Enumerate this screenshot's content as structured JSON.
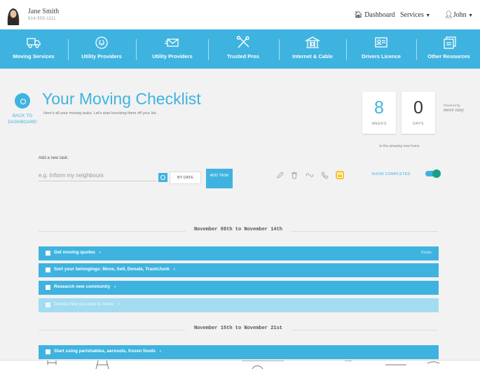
{
  "user": {
    "name": "Jane Smith",
    "phone": "614-555-1111"
  },
  "topnav": {
    "dashboard": "Dashboard",
    "services": "Services",
    "account": "John"
  },
  "categories": [
    {
      "label": "Moving Services",
      "icon": "truck-icon"
    },
    {
      "label": "Utility Providers",
      "icon": "plug-icon"
    },
    {
      "label": "Utility Providers",
      "icon": "envelope-icon"
    },
    {
      "label": "Trusted Pros",
      "icon": "tools-icon"
    },
    {
      "label": "Internet & Cable",
      "icon": "building-icon"
    },
    {
      "label": "Drivers Licence",
      "icon": "id-card-icon"
    },
    {
      "label": "Other Resources",
      "icon": "cards-icon"
    }
  ],
  "checklist": {
    "back_label": "BACK TO DASHBOARD",
    "title": "Your Moving Checklist",
    "subtitle": "Here's all your moving tasks. Let's start knocking them off your list."
  },
  "countdown": {
    "weeks": "8",
    "weeks_label": "WEEKS",
    "days": "0",
    "days_label": "DAYS",
    "note": "to the amazing new home",
    "powered_label": "Powered by",
    "powered_brand": "move easy"
  },
  "add_task": {
    "label": "Add a new task:",
    "placeholder": "e.g. Inform my neighbours",
    "by_date": "BY DATE",
    "add_button": "ADD TASK"
  },
  "filters": {
    "icons": [
      "pencil-icon",
      "trash-icon",
      "link-icon",
      "phone-icon",
      "calendar-icon"
    ],
    "show_completed": "SHOW COMPLETED",
    "show_completed_on": true
  },
  "weeks": [
    {
      "range": "November 08th to November 14th",
      "tasks": [
        {
          "name": "Get moving quotes",
          "tag": "Details",
          "done": false
        },
        {
          "name": "Sort your belongings: Move, Sell, Donate, Trash/Junk",
          "done": false
        },
        {
          "name": "Research new community",
          "done": false
        },
        {
          "name": "Decide how you plan to move",
          "done": true
        }
      ]
    },
    {
      "range": "November 15th to November 21st",
      "tasks": [
        {
          "name": "Start using perishables, aerosols, frozen foods",
          "done": false
        }
      ]
    }
  ],
  "colors": {
    "accent": "#3fb3e0",
    "done_row": "#a3dcf1",
    "toggle_knob": "#16a085",
    "active_filter": "#f7c325"
  }
}
